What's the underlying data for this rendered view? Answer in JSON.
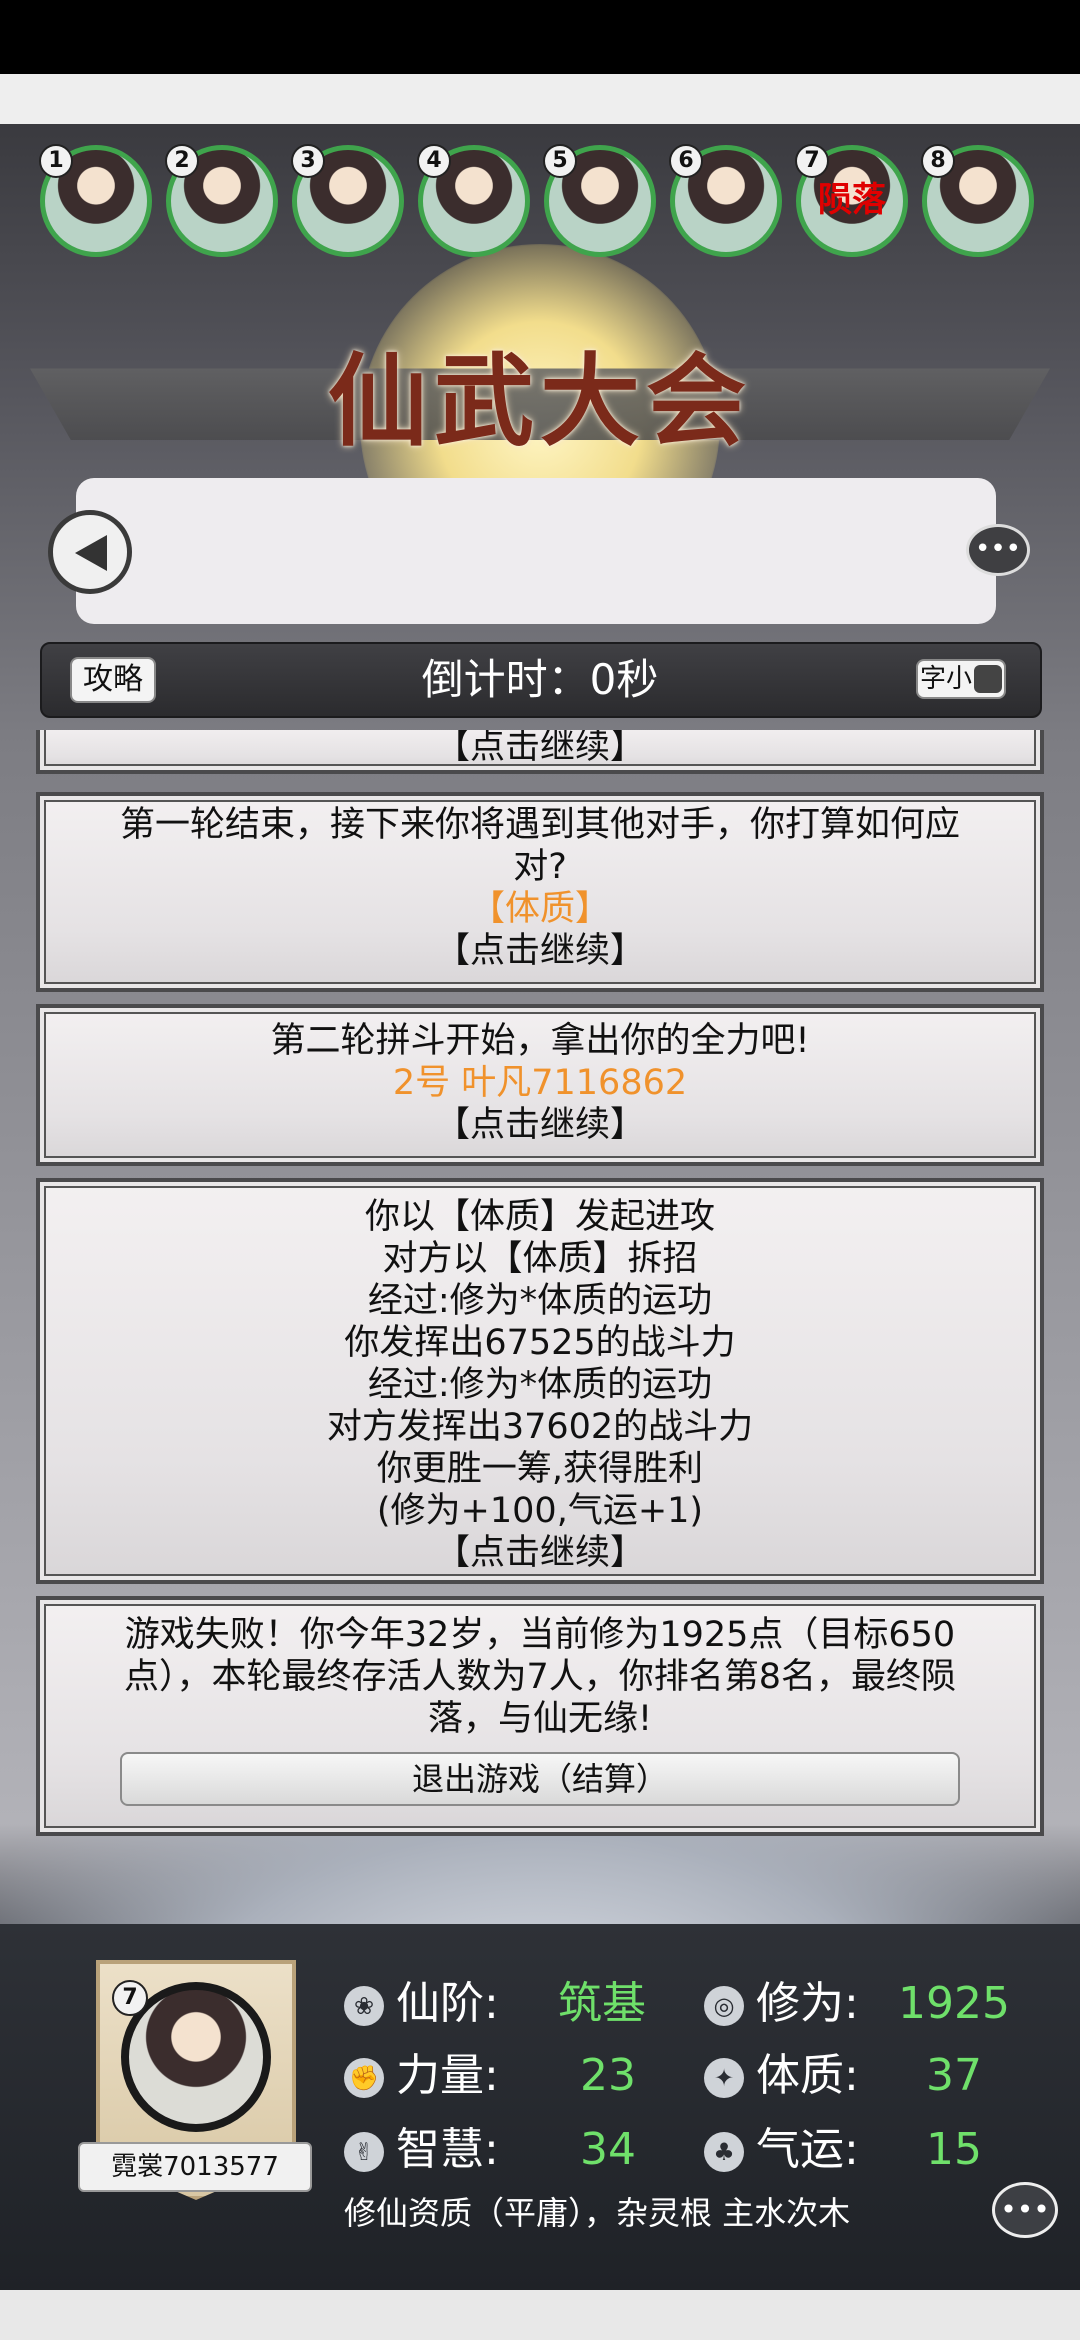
{
  "header": {
    "title": "仙武大会"
  },
  "players": [
    {
      "num": "1",
      "status": ""
    },
    {
      "num": "2",
      "status": ""
    },
    {
      "num": "3",
      "status": ""
    },
    {
      "num": "4",
      "status": ""
    },
    {
      "num": "5",
      "status": ""
    },
    {
      "num": "6",
      "status": ""
    },
    {
      "num": "7",
      "status": "陨落"
    },
    {
      "num": "8",
      "status": ""
    }
  ],
  "toolbar": {
    "guide_label": "攻略",
    "countdown": "倒计时：0秒",
    "font_toggle_label": "字小"
  },
  "log": {
    "card0": {
      "action": "【点击继续】"
    },
    "card1": {
      "line1": "第一轮结束，接下来你将遇到其他对手，你打算如何应",
      "line2": "对?",
      "choice": "【体质】",
      "action": "【点击继续】"
    },
    "card2": {
      "line1": "第二轮拼斗开始，拿出你的全力吧!",
      "opponent": "2号 叶凡7116862",
      "action": "【点击继续】"
    },
    "card3": {
      "lines": [
        "你以【体质】发起进攻",
        "对方以【体质】拆招",
        "经过:修为*体质的运功",
        "你发挥出67525的战斗力",
        "经过:修为*体质的运功",
        "对方发挥出37602的战斗力",
        "你更胜一筹,获得胜利",
        "(修为+100,气运+1)",
        "【点击继续】"
      ]
    },
    "card4": {
      "line1": "游戏失败！你今年32岁，当前修为1925点（目标650",
      "line2": "点），本轮最终存活人数为7人，你排名第8名，最终陨",
      "line3": "落，与仙无缘!",
      "exit_label": "退出游戏（结算）"
    }
  },
  "player": {
    "num": "7",
    "name": "霓裳7013577",
    "stats": {
      "rank_label": "仙阶:",
      "rank_value": "筑基",
      "cultivation_label": "修为:",
      "cultivation_value": "1925",
      "strength_label": "力量:",
      "strength_value": "23",
      "physique_label": "体质:",
      "physique_value": "37",
      "wisdom_label": "智慧:",
      "wisdom_value": "34",
      "luck_label": "气运:",
      "luck_value": "15"
    },
    "talent": "修仙资质（平庸），杂灵根 主水次木"
  },
  "colors": {
    "highlight": "#f0922c",
    "stat_value": "#6fe06a",
    "dead": "#e00000",
    "avatar_ring": "#3fa44c"
  }
}
